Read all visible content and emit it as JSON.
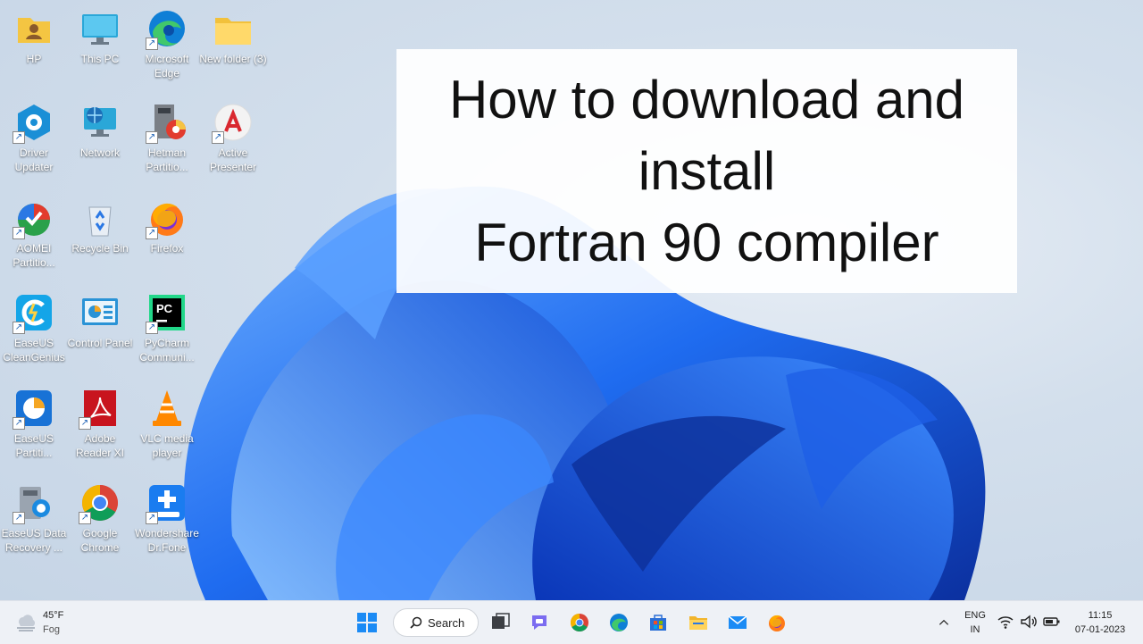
{
  "desktop": {
    "icons": [
      {
        "label": "HP",
        "icon": "user-folder-icon"
      },
      {
        "label": "This PC",
        "icon": "monitor-icon"
      },
      {
        "label": "Microsoft Edge",
        "icon": "edge-icon"
      },
      {
        "label": "New folder (3)",
        "icon": "folder-icon"
      },
      {
        "label": "Driver Updater",
        "icon": "driver-updater-icon"
      },
      {
        "label": "Network",
        "icon": "network-icon"
      },
      {
        "label": "Hetman Partitio...",
        "icon": "hetman-partition-icon"
      },
      {
        "label": "Active Presenter",
        "icon": "active-presenter-icon"
      },
      {
        "label": "AOMEI Partitio...",
        "icon": "aomei-partition-icon"
      },
      {
        "label": "Recycle Bin",
        "icon": "recycle-bin-icon"
      },
      {
        "label": "Firefox",
        "icon": "firefox-icon"
      },
      {
        "label": "EaseUS CleanGenius",
        "icon": "easeus-cleangenius-icon"
      },
      {
        "label": "Control Panel",
        "icon": "control-panel-icon"
      },
      {
        "label": "PyCharm Communi...",
        "icon": "pycharm-icon"
      },
      {
        "label": "EaseUS Partiti...",
        "icon": "easeus-partition-icon"
      },
      {
        "label": "Adobe Reader XI",
        "icon": "adobe-reader-icon"
      },
      {
        "label": "VLC media player",
        "icon": "vlc-icon"
      },
      {
        "label": "EaseUS Data Recovery ...",
        "icon": "easeus-data-recovery-icon"
      },
      {
        "label": "Google Chrome",
        "icon": "chrome-icon"
      },
      {
        "label": "Wondershare Dr.Fone",
        "icon": "drfone-icon"
      }
    ]
  },
  "overlay": {
    "line1": "How to download and",
    "line2": "install",
    "line3": "Fortran 90 compiler"
  },
  "taskbar": {
    "weather_temp": "45°F",
    "weather_desc": "Fog",
    "search_label": "Search",
    "apps": [
      "start-icon",
      "search-icon",
      "task-view-icon",
      "chat-icon",
      "chrome-icon",
      "edge-icon",
      "store-icon",
      "file-explorer-icon",
      "mail-icon",
      "firefox-icon"
    ],
    "lang_top": "ENG",
    "lang_bottom": "IN",
    "time": "11:15",
    "date": "07-01-2023"
  },
  "colors": {
    "taskbar_bg": "#eef1f6",
    "bloom_blue": "#1a5cdc",
    "desktop_bg": "#d3dfec"
  }
}
